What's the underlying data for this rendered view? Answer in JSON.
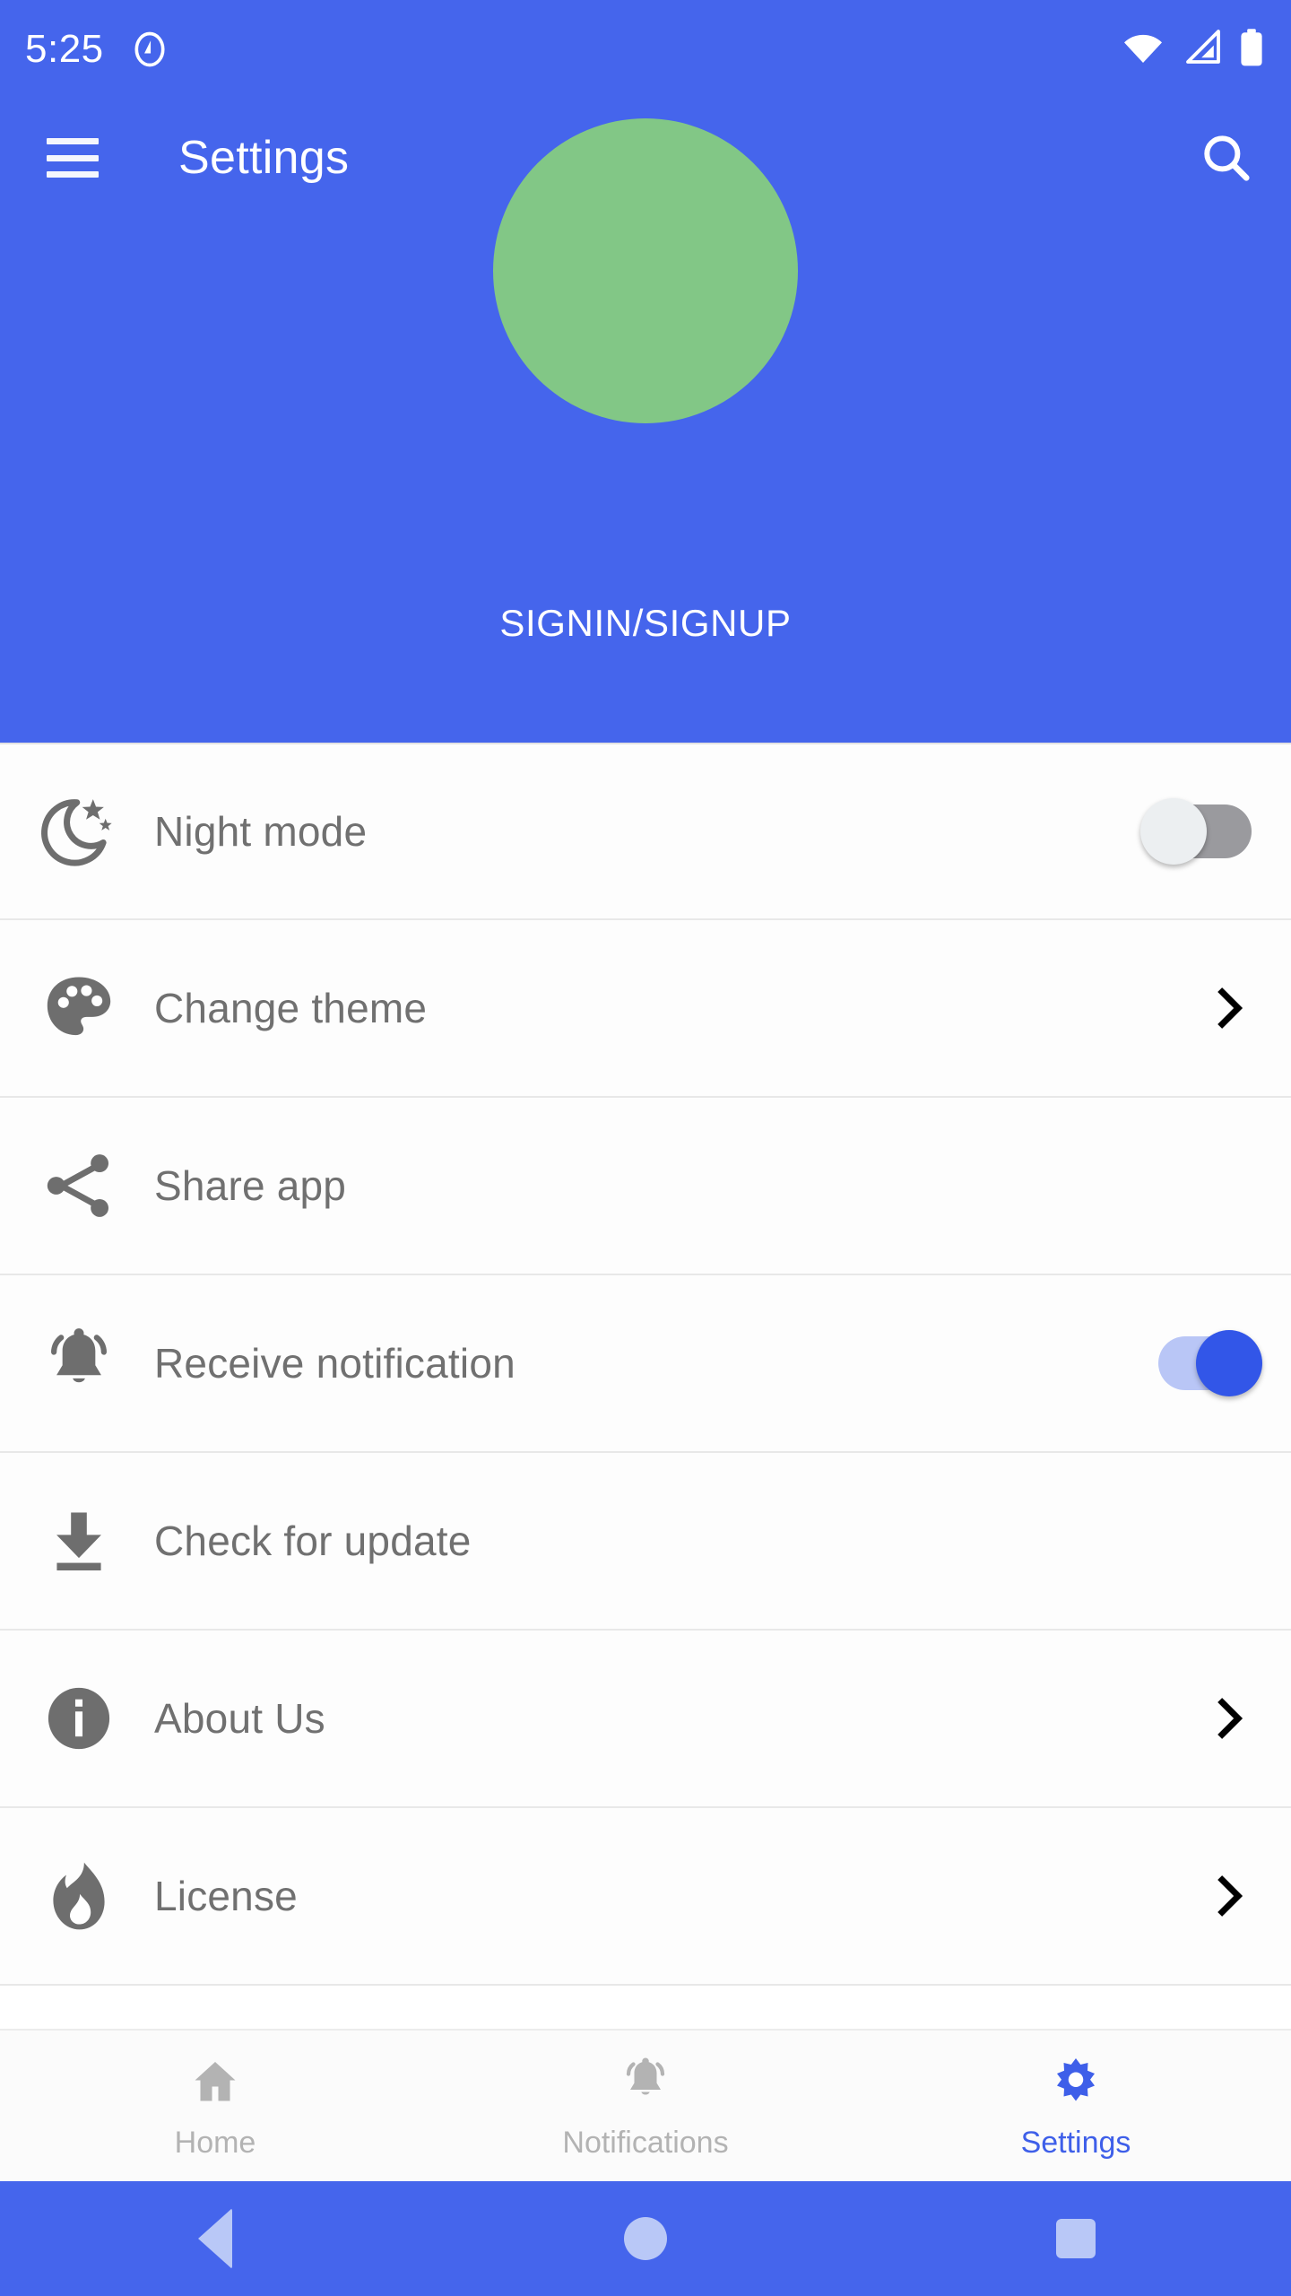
{
  "status_bar": {
    "time": "5:25",
    "android_logo_icon": "android-q-logo-icon",
    "wifi_icon": "wifi-full-icon",
    "signal_icon": "cell-signal-icon",
    "battery_icon": "battery-full-icon",
    "background_color": "#4565ec",
    "foreground_color": "#ffffff"
  },
  "app_bar": {
    "menu_icon": "hamburger-menu-icon",
    "title": "Settings",
    "search_icon": "search-icon",
    "background_color": "#4565ec"
  },
  "header": {
    "avatar_icon": "avatar-placeholder-circle",
    "avatar_color": "#82c786",
    "signin_label": "SIGNIN/SIGNUP",
    "background_color": "#4565ec"
  },
  "settings": {
    "rows": [
      {
        "label": "Night mode",
        "icon": "night-mode-moon-icon",
        "trailing": "switch",
        "switch_on": false
      },
      {
        "label": "Change theme",
        "icon": "palette-icon",
        "trailing": "chevron",
        "switch_on": null
      },
      {
        "label": "Share app",
        "icon": "share-icon",
        "trailing": "none",
        "switch_on": null
      },
      {
        "label": "Receive notification",
        "icon": "bell-ringing-icon",
        "trailing": "switch",
        "switch_on": true
      },
      {
        "label": "Check for update",
        "icon": "download-update-icon",
        "trailing": "none",
        "switch_on": null
      },
      {
        "label": "About Us",
        "icon": "info-circle-icon",
        "trailing": "chevron",
        "switch_on": null
      },
      {
        "label": "License",
        "icon": "flame-icon",
        "trailing": "chevron",
        "switch_on": null
      }
    ],
    "label_color": "#707070",
    "icon_color": "#6e6e6e",
    "chevron_color": "#000000",
    "switch_on_color": "#3256e8",
    "switch_off_color": "#9a9a9e"
  },
  "bottom_nav": {
    "items": [
      {
        "label": "Home",
        "icon": "home-icon",
        "active": false
      },
      {
        "label": "Notifications",
        "icon": "bell-icon",
        "active": false
      },
      {
        "label": "Settings",
        "icon": "gear-icon",
        "active": true
      }
    ],
    "active_color": "#3e5fe9",
    "inactive_color": "#b3b3b3"
  },
  "android_nav": {
    "back_icon": "back-triangle-icon",
    "home_icon": "home-circle-icon",
    "recents_icon": "recents-square-icon",
    "background_color": "#4565ec",
    "icon_color": "#b9c8f7"
  }
}
